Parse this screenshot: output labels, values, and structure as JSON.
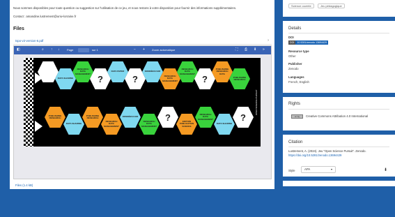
{
  "main": {
    "intro": "Nous sommes disponibles pour toute question ou suggestion sur l'utilisation de ce jeu, et nous restons à votre disposition pour fournir des informations supplémentaires.",
    "contact": "Contact : amandine.lustrement@univ-lorraine.fr",
    "files_heading": "Files",
    "file_name": "tspo-v2-version-6.pdf",
    "files_footer_link": "Files (1.4 kB)"
  },
  "viewer": {
    "toolbar": {
      "page_label": "Page",
      "page_of": "sur 1",
      "zoom_minus": "−",
      "zoom_plus": "+",
      "zoom_value": "Zoom automatique"
    },
    "board_top": [
      {
        "text": "",
        "color": "#ffffff"
      },
      {
        "text": "DATA SHARING",
        "color": "#7fd8f0"
      },
      {
        "text": "RESEARCH DATA MANAGEMENT",
        "color": "#39d33c"
      },
      {
        "text": "?",
        "color": "#ffffff"
      },
      {
        "text": "DATA PAPER",
        "color": "#7fd8f0"
      },
      {
        "text": "?",
        "color": "#ffffff"
      },
      {
        "text": "DONNÉES FAIR",
        "color": "#7fd8f0"
      },
      {
        "text": "RESEARCH DATA MANAGEMENT",
        "color": "#f59a23"
      },
      {
        "text": "RESEARCH DATA MANAGEMENT",
        "color": "#39d33c"
      },
      {
        "text": "?",
        "color": "#ffffff"
      },
      {
        "text": "PUBLISHING RESEARCH DATA",
        "color": "#f59a23"
      },
      {
        "text": "PUBLISHING RESEARCH",
        "color": "#39d33c"
      }
    ],
    "board_bottom": [
      {
        "text": "PUBLISHING RESEARCH",
        "color": "#f59a23"
      },
      {
        "text": "DATA SHARING",
        "color": "#7fd8f0"
      },
      {
        "text": "PUBLISHING RESEARCH",
        "color": "#f59a23"
      },
      {
        "text": "RESEARCH DATA MANAGEMENT",
        "color": "#f59a23"
      },
      {
        "text": "DONNÉES FAIR",
        "color": "#7fd8f0"
      },
      {
        "text": "RESEARCH DATA MANAGEMENT",
        "color": "#39d33c"
      },
      {
        "text": "?",
        "color": "#ffffff"
      },
      {
        "text": "EDITION PUBLICATION SCIENCE",
        "color": "#f59a23"
      },
      {
        "text": "RESEARCH DATA MANAGEMENT",
        "color": "#39d33c"
      },
      {
        "text": "DATA SHARING",
        "color": "#7fd8f0"
      },
      {
        "text": "?",
        "color": "#ffffff"
      }
    ],
    "board_right_label": "OPEN SCIENCE PURSUIT"
  },
  "sidebar": {
    "tags": [
      "Science ouverte",
      "Jeu pédagogique"
    ],
    "details": {
      "title": "Details",
      "doi_key": "DOI",
      "doi_label": "DOI",
      "doi_value": "10.5281/zenodo.13694429",
      "resource_type_key": "Resource type",
      "resource_type_value": "Other",
      "publisher_key": "Publisher",
      "publisher_value": "Zenodo",
      "languages_key": "Languages",
      "languages_value": "French, English"
    },
    "rights": {
      "title": "Rights",
      "icon_text": "cc by",
      "license": "Creative Commons Attribution 4.0 International"
    },
    "citation": {
      "title": "Citation",
      "text": "Lustrement, A. (2024). Jeu \"Open Science Pursuit\". Zenodo.",
      "url": "https://doi.org/10.5281/zenodo.13694429",
      "style_label": "Style",
      "style_value": "APA"
    }
  },
  "colors": {
    "background": "#1f5fa8",
    "toolbar": "#3a64b6",
    "link": "#1a64b4",
    "hex_blue": "#7fd8f0",
    "hex_green": "#39d33c",
    "hex_orange": "#f59a23"
  },
  "icons": [
    "sidebar-toggle-icon",
    "search-icon",
    "arrow-up-icon",
    "arrow-down-icon",
    "fullscreen-icon",
    "print-icon",
    "download-icon",
    "menu-icon",
    "chevron-right-icon",
    "cc-by-icon"
  ]
}
